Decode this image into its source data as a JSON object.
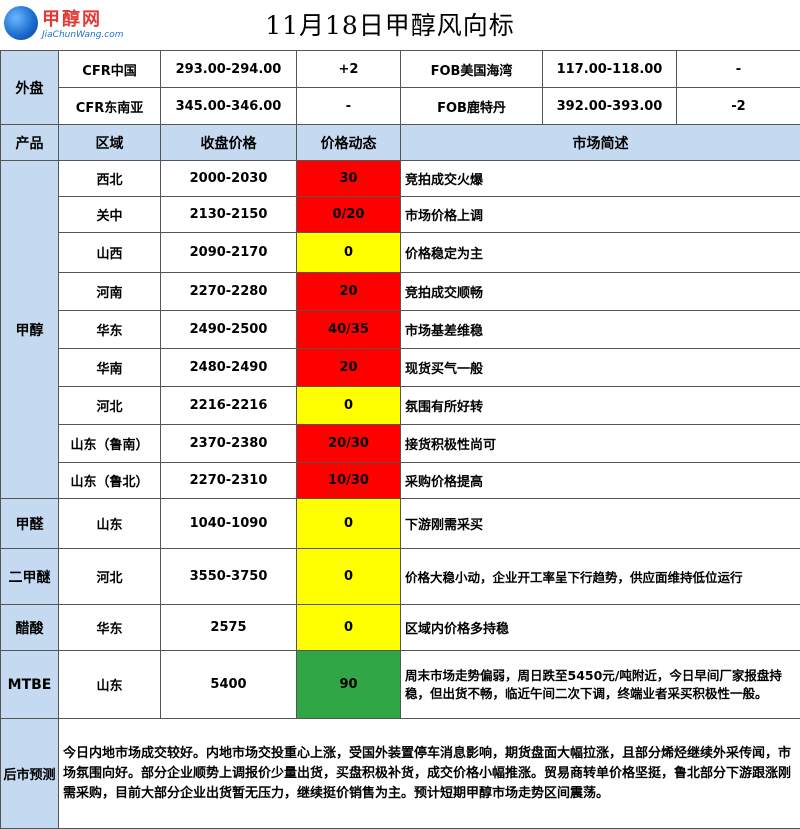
{
  "logo": {
    "brand": "甲醇网",
    "url": "JiaChunWang.com"
  },
  "title": "11月18日甲醇风向标",
  "foreign": {
    "label": "外盘",
    "rows": [
      {
        "name1": "CFR中国",
        "price1": "293.00-294.00",
        "change1": "+2",
        "name2": "FOB美国海湾",
        "price2": "117.00-118.00",
        "change2": "-"
      },
      {
        "name1": "CFR东南亚",
        "price1": "345.00-346.00",
        "change1": "-",
        "name2": "FOB鹿特丹",
        "price2": "392.00-393.00",
        "change2": "-2"
      }
    ]
  },
  "headers": {
    "product": "产品",
    "region": "区域",
    "close": "收盘价格",
    "change": "价格动态",
    "desc": "市场简述"
  },
  "products": [
    {
      "name": "甲醇",
      "rows": [
        {
          "region": "西北",
          "price": "2000-2030",
          "change": "30",
          "color": "#ff0000",
          "desc": "竞拍成交火爆"
        },
        {
          "region": "关中",
          "price": "2130-2150",
          "change": "0/20",
          "color": "#ff0000",
          "desc": "市场价格上调"
        },
        {
          "region": "山西",
          "price": "2090-2170",
          "change": "0",
          "color": "#ffff00",
          "desc": "价格稳定为主"
        },
        {
          "region": "河南",
          "price": "2270-2280",
          "change": "20",
          "color": "#ff0000",
          "desc": "竞拍成交顺畅"
        },
        {
          "region": "华东",
          "price": "2490-2500",
          "change": "40/35",
          "color": "#ff0000",
          "desc": "市场基差维稳"
        },
        {
          "region": "华南",
          "price": "2480-2490",
          "change": "20",
          "color": "#ff0000",
          "desc": "现货买气一般"
        },
        {
          "region": "河北",
          "price": "2216-2216",
          "change": "0",
          "color": "#ffff00",
          "desc": "氛围有所好转"
        },
        {
          "region": "山东（鲁南）",
          "price": "2370-2380",
          "change": "20/30",
          "color": "#ff0000",
          "desc": "接货积极性尚可"
        },
        {
          "region": "山东（鲁北）",
          "price": "2270-2310",
          "change": "10/30",
          "color": "#ff0000",
          "desc": "采购价格提高"
        }
      ]
    },
    {
      "name": "甲醛",
      "rows": [
        {
          "region": "山东",
          "price": "1040-1090",
          "change": "0",
          "color": "#ffff00",
          "desc": "下游刚需采买"
        }
      ]
    },
    {
      "name": "二甲醚",
      "rows": [
        {
          "region": "河北",
          "price": "3550-3750",
          "change": "0",
          "color": "#ffff00",
          "desc": "价格大稳小动，企业开工率呈下行趋势，供应面维持低位运行"
        }
      ]
    },
    {
      "name": "醋酸",
      "rows": [
        {
          "region": "华东",
          "price": "2575",
          "change": "0",
          "color": "#ffff00",
          "desc": "区域内价格多持稳"
        }
      ]
    },
    {
      "name": "MTBE",
      "rows": [
        {
          "region": "山东",
          "price": "5400",
          "change": "90",
          "color": "#31a645",
          "desc": "周末市场走势偏弱，周日跌至5450元/吨附近，今日早间厂家报盘持稳，但出货不畅，临近午间二次下调，终端业者采买积极性一般。"
        }
      ]
    }
  ],
  "forecast": {
    "label": "后市预测",
    "text": "今日内地市场成交较好。内地市场交投重心上涨，受国外装置停车消息影响，期货盘面大幅拉涨，且部分烯烃继续外采传闻，市场氛围向好。部分企业顺势上调报价少量出货，买盘积极补货，成交价格小幅推涨。贸易商转单价格坚挺，鲁北部分下游跟涨刚需采购，目前大部分企业出货暂无压力，继续挺价销售为主。预计短期甲醇市场走势区间震荡。"
  }
}
